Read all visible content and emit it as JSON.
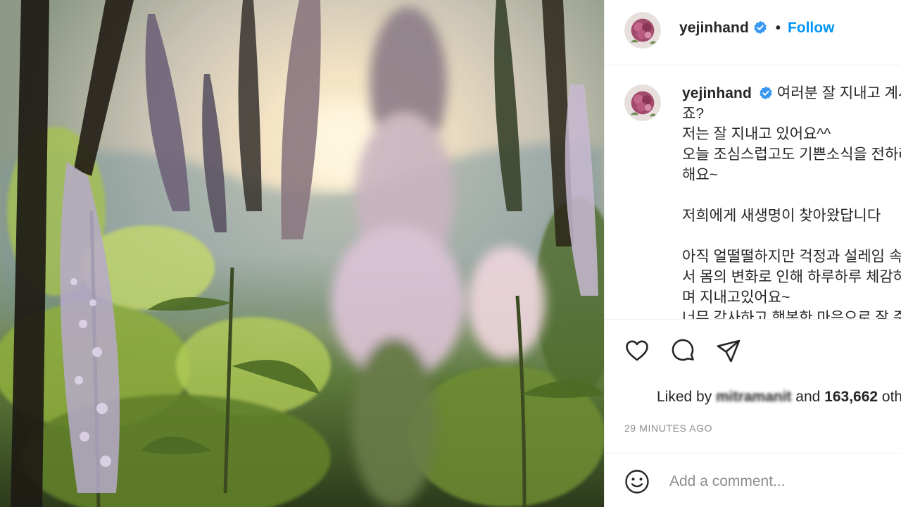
{
  "colors": {
    "accent": "#0095f6",
    "verified": "#3897f0",
    "text": "#262626",
    "muted": "#8e8e8e",
    "divider": "#efefef"
  },
  "post": {
    "image_description_icon": "photo-of-flowers-at-sunset"
  },
  "header": {
    "username": "yejinhand",
    "separator": "•",
    "follow_label": "Follow"
  },
  "caption": {
    "username": "yejinhand",
    "text": "여러분 잘 지내고 계시\n죠?\n저는 잘 지내고 있어요^^\n오늘 조심스럽고도 기쁜소식을 전하려고\n해요~\n\n저희에게 새생명이 찾아왔답니다 \n\n아직 얼떨떨하지만 걱정과 설레임 속에\n서 몸의 변화로 인해 하루하루 체감하\n며 지내고있어요~\n너무 감사하고 행복한 마음으로 잘 준비"
  },
  "actions": {
    "like_icon": "heart-icon",
    "comment_icon": "comment-icon",
    "share_icon": "send-icon"
  },
  "likes": {
    "prefix": "Liked by",
    "who": "mitramanit",
    "and": "and",
    "count": "163,662",
    "suffix": "others"
  },
  "timestamp": "29 MINUTES AGO",
  "comment": {
    "placeholder": "Add a comment..."
  }
}
